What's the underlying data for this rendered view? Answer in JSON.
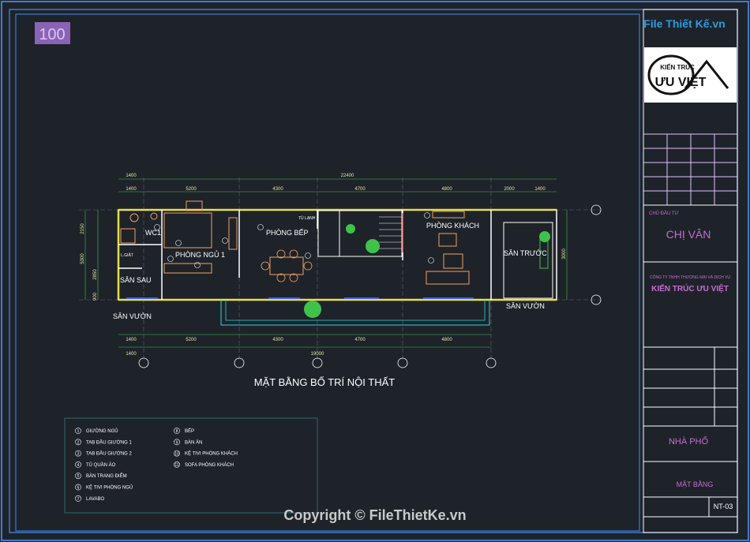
{
  "scale_badge": "100",
  "watermark_site": "File Thiết Kế.vn",
  "plan": {
    "title": "MẶT BẰNG BỐ TRÍ NỘI THẤT",
    "rooms": {
      "wc": "WC1",
      "bedroom": "PHÒNG NGỦ 1",
      "kitchen": "PHÒNG BẾP",
      "fridge": "TỦ LẠNH",
      "living": "PHÒNG KHÁCH",
      "front_yard": "SÂN TRƯỚC",
      "back_yard": "SÂN SAU",
      "garden_left": "SÂN VƯỜN",
      "garden_right": "SÂN VƯỜN",
      "laundry": "L.GIẶT"
    },
    "dims_top_total": "22400",
    "dims_top": [
      "1400",
      "5200",
      "4300",
      "4700",
      "4800",
      "2000",
      "1400"
    ],
    "dims_top_first": "1400",
    "dims_left": [
      "2150",
      "5300",
      "2850",
      "900"
    ],
    "dims_bottom_total": "19000",
    "dims_bottom": [
      "1400",
      "5200",
      "4300",
      "4700",
      "4800"
    ],
    "dim_right": "3000"
  },
  "legend": {
    "col1": [
      {
        "n": "1",
        "label": "GIƯỜNG NGỦ"
      },
      {
        "n": "2",
        "label": "TAB ĐẦU GIƯỜNG 1"
      },
      {
        "n": "3",
        "label": "TAB ĐẦU GIƯỜNG 2"
      },
      {
        "n": "4",
        "label": "TỦ QUẦN ÁO"
      },
      {
        "n": "5",
        "label": "BÀN TRANG ĐIỂM"
      },
      {
        "n": "6",
        "label": "KỆ TIVI PHÒNG NGỦ"
      },
      {
        "n": "7",
        "label": "LAVABO"
      }
    ],
    "col2": [
      {
        "n": "8",
        "label": "BẾP"
      },
      {
        "n": "9",
        "label": "BÀN ĂN"
      },
      {
        "n": "10",
        "label": "KỆ TIVI PHÒNG KHÁCH"
      },
      {
        "n": "11",
        "label": "SOFA PHÒNG KHÁCH"
      }
    ]
  },
  "title_block": {
    "logo_line1": "KIẾN TRÚC",
    "logo_line2": "ƯU VIỆT",
    "owner_label": "CHỦ ĐẦU TƯ",
    "owner": "CHỊ VÂN",
    "company_small": "CÔNG TY TNHH THƯƠNG MẠI VÀ DỊCH VỤ",
    "company": "KIẾN TRÚC ƯU VIỆT",
    "project_type": "NHÀ PHỐ",
    "sheet_title": "MẶT BẰNG",
    "sheet_no": "NT-03"
  },
  "copyright": "Copyright © FileThietKe.vn"
}
